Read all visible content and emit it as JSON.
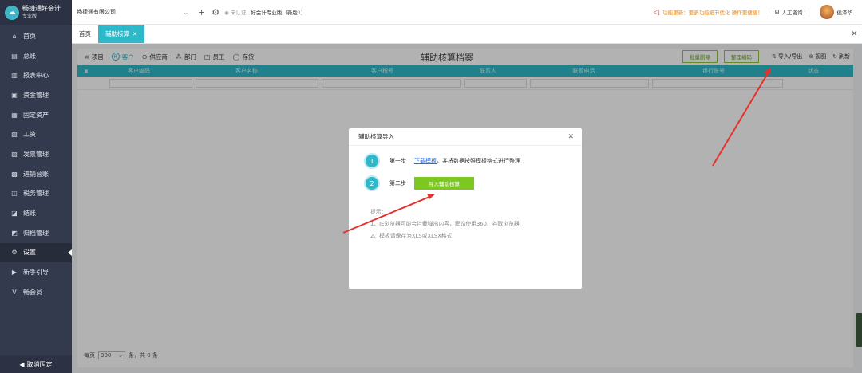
{
  "app": {
    "logo_name": "畅捷通好会计",
    "logo_sub": "专业版"
  },
  "sidebar": {
    "items": [
      {
        "label": "首页",
        "icon": "home-icon",
        "glyph": "⌂"
      },
      {
        "label": "总账",
        "icon": "ledger-icon",
        "glyph": "▤"
      },
      {
        "label": "报表中心",
        "icon": "chart-icon",
        "glyph": "▥"
      },
      {
        "label": "资金管理",
        "icon": "bank-icon",
        "glyph": "▣"
      },
      {
        "label": "固定资产",
        "icon": "asset-icon",
        "glyph": "▦"
      },
      {
        "label": "工资",
        "icon": "salary-icon",
        "glyph": "▧"
      },
      {
        "label": "发票管理",
        "icon": "invoice-icon",
        "glyph": "▨"
      },
      {
        "label": "进销台账",
        "icon": "stock-icon",
        "glyph": "▩"
      },
      {
        "label": "税务管理",
        "icon": "tax-icon",
        "glyph": "◫"
      },
      {
        "label": "结账",
        "icon": "close-period-icon",
        "glyph": "◪"
      },
      {
        "label": "归档管理",
        "icon": "archive-icon",
        "glyph": "◩"
      },
      {
        "label": "设置",
        "icon": "gear-icon",
        "glyph": "⚙"
      },
      {
        "label": "新手引导",
        "icon": "guide-icon",
        "glyph": "▶"
      },
      {
        "label": "畅会员",
        "icon": "vip-icon",
        "glyph": "V"
      }
    ],
    "active_index": 11,
    "unpin_label": "取消固定"
  },
  "topbar": {
    "company": "畅捷通有限公司",
    "auth": "未认证",
    "product": "好会计专业版（新版1）",
    "notice": "功能更新：更多功能细节优化 操作更便捷！",
    "support": "人工咨询",
    "username": "侯泽华"
  },
  "tabs": [
    {
      "label": "首页",
      "active": false
    },
    {
      "label": "辅助核算",
      "active": true
    }
  ],
  "toolbar": {
    "title": "辅助核算档案",
    "types": [
      {
        "label": "项目",
        "icon": "list-icon",
        "glyph": "≡",
        "active": false
      },
      {
        "label": "客户",
        "icon": "customer-icon",
        "glyph": "R",
        "active": true
      },
      {
        "label": "供应商",
        "icon": "supplier-icon",
        "glyph": "⊙",
        "active": false
      },
      {
        "label": "部门",
        "icon": "department-icon",
        "glyph": "⁂",
        "active": false
      },
      {
        "label": "员工",
        "icon": "employee-icon",
        "glyph": "◳",
        "active": false
      },
      {
        "label": "存货",
        "icon": "inventory-icon",
        "glyph": "◯",
        "active": false
      }
    ],
    "batch_delete": "批量删除",
    "organize_code": "整理编码",
    "import_export": "导入/导出",
    "view": "视图",
    "refresh": "刷新"
  },
  "grid": {
    "columns": [
      "客户编码",
      "客户名称",
      "客户税号",
      "联系人",
      "联系电话",
      "银行账号",
      "状态"
    ]
  },
  "pager": {
    "per_page_label": "每页",
    "per_page_value": "300",
    "total_label": "条，共 0 条"
  },
  "modal": {
    "title": "辅助核算导入",
    "step1_num": "1",
    "step1_label": "第一步",
    "step1_link": "下载模板",
    "step1_text": "，并将数据按照模板格式进行整理",
    "step2_num": "2",
    "step2_label": "第二步",
    "step2_button": "导入辅助核算",
    "tips_title": "提示：",
    "tip1": "1、IE浏览器可能会拦截弹出内容，建议使用360、谷歌浏览器",
    "tip2": "2、模板请保存为XLS或XLSX格式"
  },
  "colors": {
    "accent": "#2eb8c9",
    "sidebar_bg": "#333a4d",
    "green_button": "#7cc720",
    "arrow": "#e5322d"
  }
}
